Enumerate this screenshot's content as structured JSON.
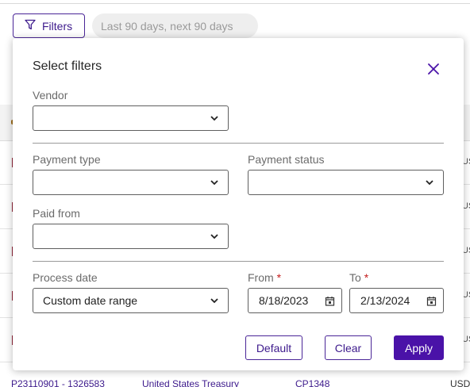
{
  "toolbar": {
    "filters_label": "Filters",
    "date_range_chip": "Last 90 days, next 90 days"
  },
  "background_table": {
    "currency_peek": "USD",
    "last_row": {
      "payment_id": "P23110901 - 1326583",
      "vendor": "United States Treasury",
      "code": "CP1348",
      "currency": "USD"
    }
  },
  "modal": {
    "title": "Select filters",
    "vendor": {
      "label": "Vendor",
      "value": ""
    },
    "payment_type": {
      "label": "Payment type",
      "value": ""
    },
    "payment_status": {
      "label": "Payment status",
      "value": ""
    },
    "paid_from": {
      "label": "Paid from",
      "value": ""
    },
    "process_date": {
      "label": "Process date",
      "value": "Custom date range"
    },
    "from": {
      "label": "From",
      "required_mark": "*",
      "value": "8/18/2023"
    },
    "to": {
      "label": "To",
      "required_mark": "*",
      "value": "2/13/2024"
    },
    "buttons": {
      "default": "Default",
      "clear": "Clear",
      "apply": "Apply"
    }
  },
  "icons": {
    "filter": "filter-funnel-icon",
    "close": "close-x-icon",
    "chevron": "chevron-down-icon",
    "calendar": "calendar-icon"
  },
  "colors": {
    "accent": "#4a12a8",
    "accent_text": "#3d1a8c",
    "required": "#c41d1d"
  }
}
